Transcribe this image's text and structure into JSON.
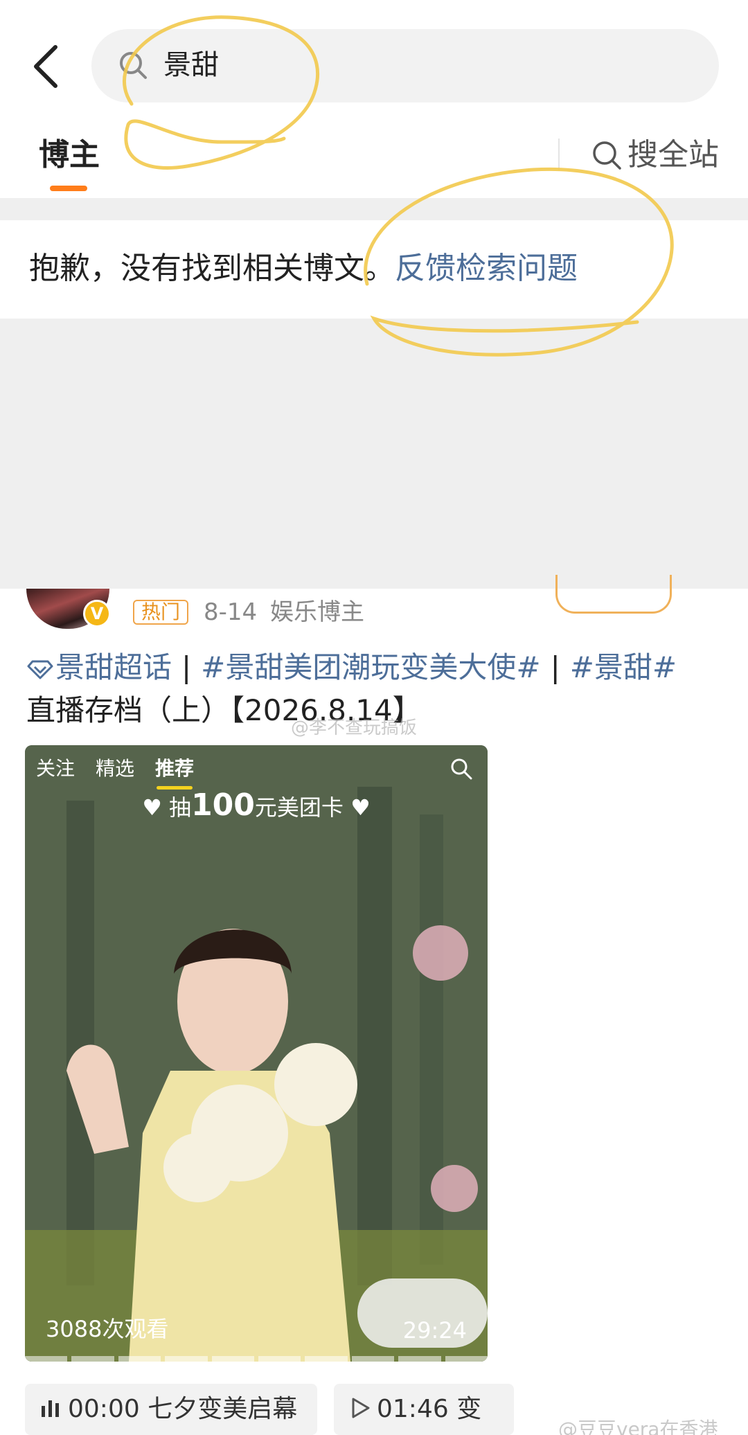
{
  "search": {
    "query": "景甜",
    "back_icon": "chevron-left-icon",
    "search_icon": "search-icon"
  },
  "tabs": {
    "active_label": "博主",
    "site_search_label": "搜全站",
    "accent_color": "#ff7d1a"
  },
  "empty_state": {
    "message": "抱歉，没有找到相关博文。",
    "feedback_link": "反馈检索问题",
    "link_color": "#4d6e99"
  },
  "post": {
    "hot_badge": "热门",
    "date": "8-14",
    "author_role": "娱乐博主",
    "verified_badge": "V",
    "super_topic": "景甜超话",
    "separator": "|",
    "hashtag_1": "#景甜美团潮玩变美大使#",
    "hashtag_2": "#景甜#",
    "text_line2": "直播存档（上）【2026.8.14】",
    "watermark": "@李不查玩搞饭",
    "video": {
      "nav_follow": "关注",
      "nav_featured": "精选",
      "nav_recommend": "推荐",
      "promo_prefix": "抽",
      "promo_amount": "100",
      "promo_suffix": "元美团卡",
      "views": "3088次观看",
      "duration": "29:24"
    },
    "chapters": [
      {
        "time": "00:00",
        "title": "七夕变美启幕"
      },
      {
        "time": "01:46",
        "title": "变"
      }
    ],
    "footer_watermark": "@豆豆vera在香港"
  }
}
